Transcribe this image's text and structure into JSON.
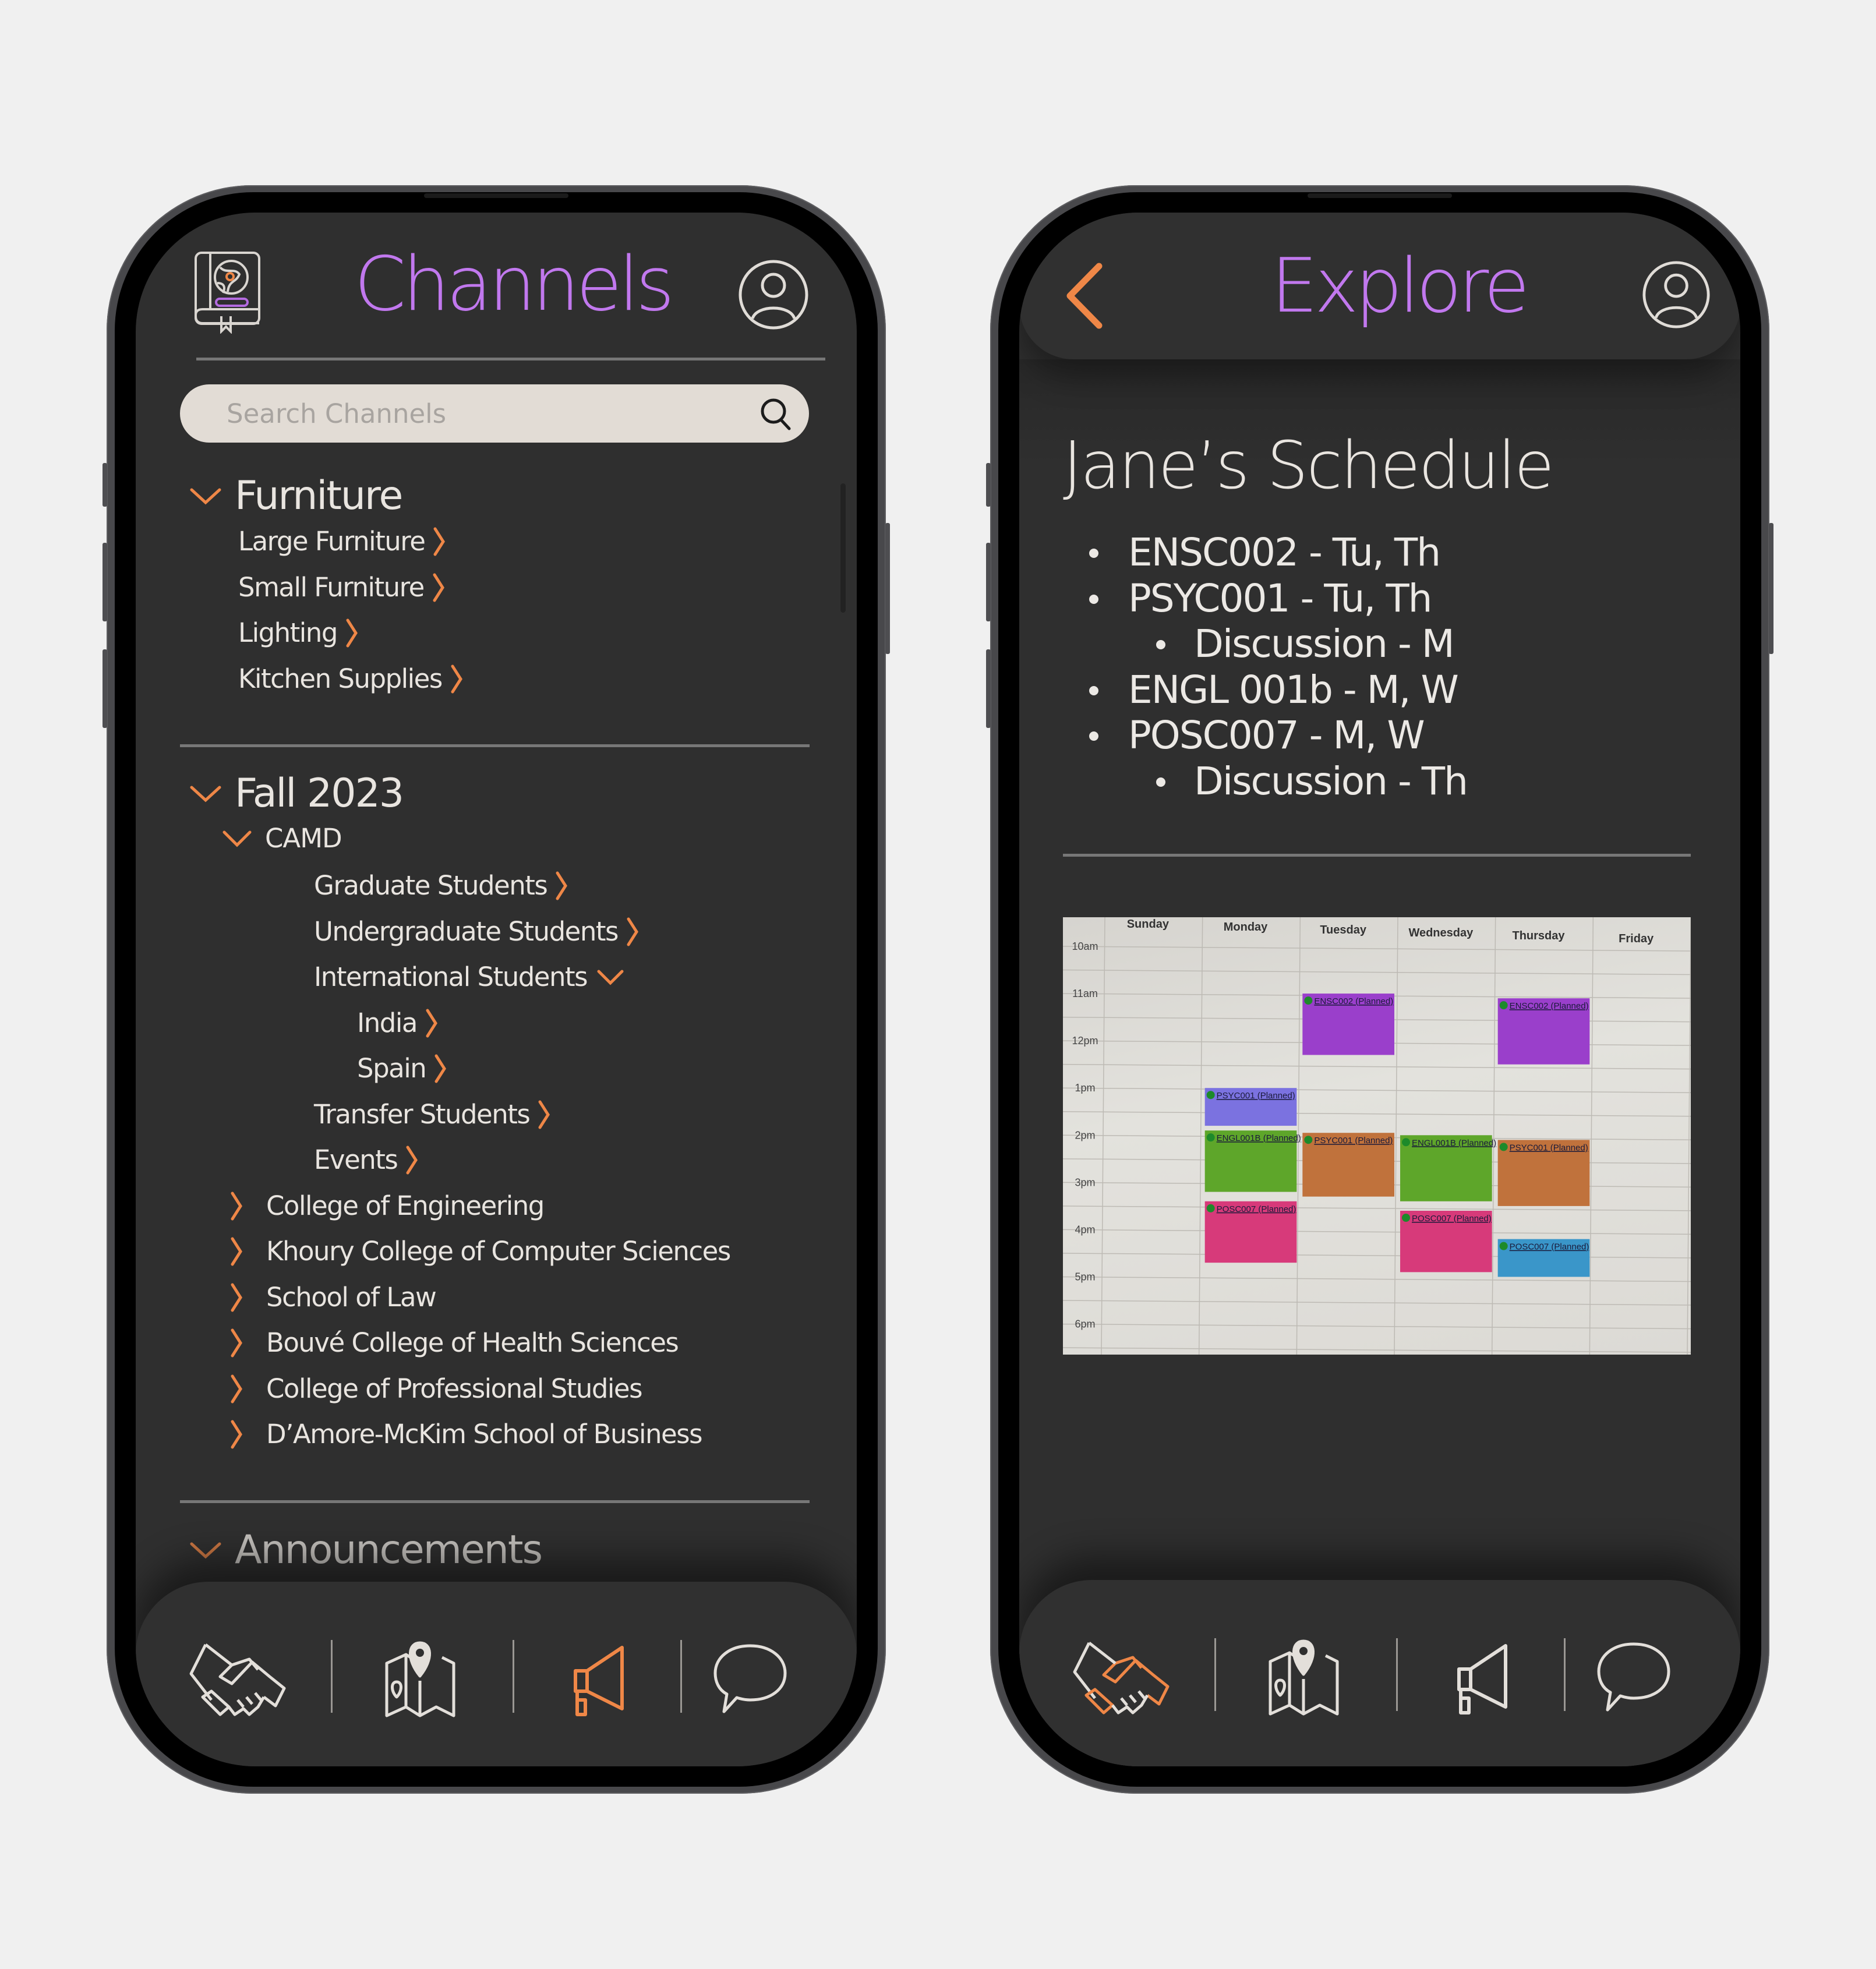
{
  "colors": {
    "accent_purple": "#c178ee",
    "accent_orange": "#ef8747",
    "text_light": "#e9e5e0",
    "screen_bg": "#2f2f2f",
    "search_bg": "#e2dcd5",
    "page_bg": "#f0f0f0"
  },
  "channels_screen": {
    "title": "Channels",
    "header_left_icon": "book-globe-icon",
    "header_right_icon": "user-avatar-icon",
    "search": {
      "placeholder": "Search Channels",
      "value": "",
      "icon": "search-icon"
    },
    "sections": [
      {
        "label": "Furniture",
        "expanded": true,
        "children": [
          {
            "label": "Large Furniture"
          },
          {
            "label": "Small Furniture"
          },
          {
            "label": "Lighting"
          },
          {
            "label": "Kitchen Supplies"
          }
        ]
      },
      {
        "label": "Fall 2023",
        "expanded": true,
        "groups": [
          {
            "label": "CAMD",
            "expanded": true,
            "children": [
              {
                "label": "Graduate Students"
              },
              {
                "label": "Undergraduate Students"
              },
              {
                "label": "International Students",
                "expanded": true,
                "children": [
                  {
                    "label": "India"
                  },
                  {
                    "label": "Spain"
                  }
                ]
              },
              {
                "label": "Transfer Students"
              },
              {
                "label": "Events"
              }
            ]
          },
          {
            "label": "College of Engineering",
            "expanded": false
          },
          {
            "label": "Khoury College of Computer Sciences",
            "expanded": false
          },
          {
            "label": "School of Law",
            "expanded": false
          },
          {
            "label": "Bouvé College of Health Sciences",
            "expanded": false
          },
          {
            "label": "College of Professional Studies",
            "expanded": false
          },
          {
            "label": "D’Amore-McKim School of Business",
            "expanded": false
          }
        ]
      },
      {
        "label": "Announcements",
        "expanded": true
      }
    ],
    "nav": {
      "items": [
        {
          "name": "connect",
          "icon": "handshake-icon",
          "active": false
        },
        {
          "name": "explore",
          "icon": "map-pin-icon",
          "active": false
        },
        {
          "name": "channels",
          "icon": "megaphone-icon",
          "active": true
        },
        {
          "name": "messages",
          "icon": "chat-bubble-icon",
          "active": false
        }
      ]
    }
  },
  "explore_screen": {
    "title": "Explore",
    "back_icon": "chevron-left-icon",
    "header_right_icon": "user-avatar-icon",
    "schedule_title": "Jane’s Schedule",
    "courses": [
      {
        "text": "ENSC002 - Tu, Th",
        "level": 1
      },
      {
        "text": "PSYC001 - Tu, Th",
        "level": 1
      },
      {
        "text": "Discussion - M",
        "level": 2
      },
      {
        "text": "ENGL 001b - M, W",
        "level": 1
      },
      {
        "text": "POSC007 - M, W",
        "level": 1
      },
      {
        "text": "Discussion - Th",
        "level": 2
      }
    ],
    "calendar_photo": {
      "days": [
        "Sunday",
        "Monday",
        "Tuesday",
        "Wednesday",
        "Thursday",
        "Friday"
      ],
      "times": [
        "10am",
        "11am",
        "12pm",
        "1pm",
        "2pm",
        "3pm",
        "4pm",
        "5pm",
        "6pm"
      ],
      "events": [
        {
          "label": "ENSC002 (Planned)",
          "day": "Tuesday",
          "start": 11.0,
          "end": 12.3,
          "color": "#9a3fcb"
        },
        {
          "label": "ENSC002 (Planned)",
          "day": "Thursday",
          "start": 11.1,
          "end": 12.5,
          "color": "#9a3fcb"
        },
        {
          "label": "PSYC001 (Planned)",
          "day": "Monday",
          "start": 13.0,
          "end": 13.8,
          "color": "#7b72e0"
        },
        {
          "label": "ENGL001B (Planned)",
          "day": "Monday",
          "start": 13.9,
          "end": 15.2,
          "color": "#5ea62a"
        },
        {
          "label": "PSYC001 (Planned)",
          "day": "Tuesday",
          "start": 13.95,
          "end": 15.3,
          "color": "#c0723c"
        },
        {
          "label": "ENGL001B (Planned)",
          "day": "Wednesday",
          "start": 14.0,
          "end": 15.4,
          "color": "#5ea62a"
        },
        {
          "label": "PSYC001 (Planned)",
          "day": "Thursday",
          "start": 14.1,
          "end": 15.5,
          "color": "#c0723c"
        },
        {
          "label": "POSC007 (Planned)",
          "day": "Monday",
          "start": 15.4,
          "end": 16.7,
          "color": "#d73a7a"
        },
        {
          "label": "POSC007 (Planned)",
          "day": "Wednesday",
          "start": 15.6,
          "end": 16.9,
          "color": "#d73a7a"
        },
        {
          "label": "POSC007 (Planned)",
          "day": "Thursday",
          "start": 16.2,
          "end": 17.0,
          "color": "#3a96c9"
        }
      ]
    },
    "nav": {
      "items": [
        {
          "name": "connect",
          "icon": "handshake-icon",
          "active": true
        },
        {
          "name": "explore",
          "icon": "map-pin-icon",
          "active": false
        },
        {
          "name": "channels",
          "icon": "megaphone-icon",
          "active": false
        },
        {
          "name": "messages",
          "icon": "chat-bubble-icon",
          "active": false
        }
      ]
    }
  }
}
